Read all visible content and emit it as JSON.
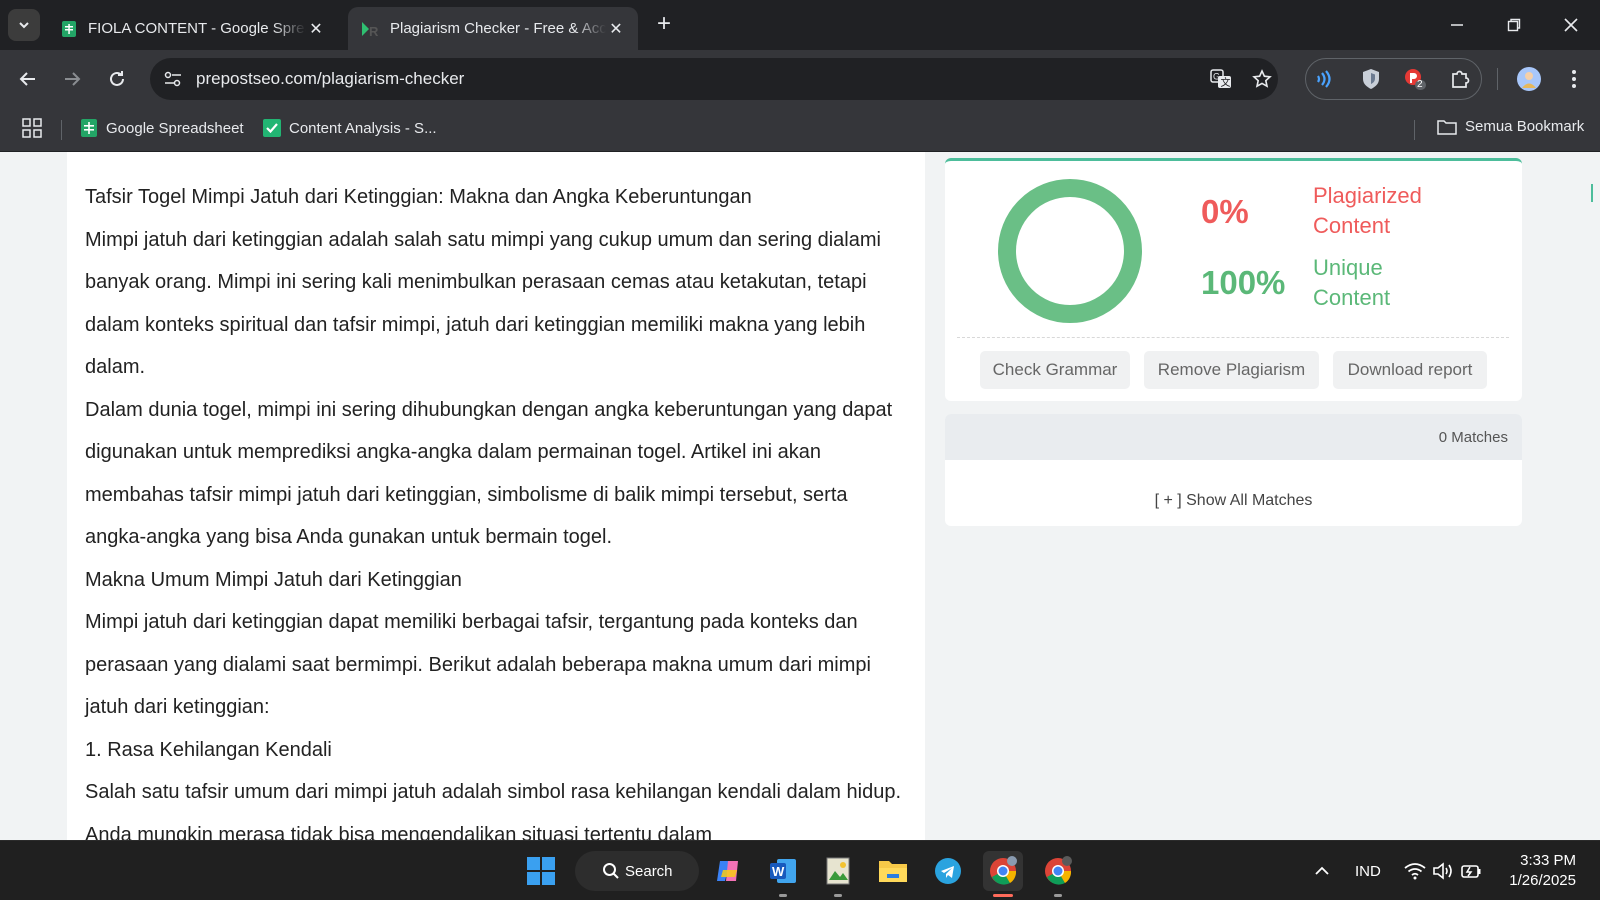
{
  "browser": {
    "tabs": [
      {
        "title": "FIOLA CONTENT - Google Spreadsheet",
        "active": false
      },
      {
        "title": "Plagiarism Checker - Free & Accurate",
        "active": true
      }
    ],
    "url": "prepostseo.com/plagiarism-checker",
    "bookmarks": [
      "Google Spreadsheet",
      "Content Analysis - S..."
    ],
    "all_bookmarks_label": "Semua Bookmark",
    "extension_badge": "2"
  },
  "article": {
    "paragraphs": [
      "Tafsir Togel Mimpi Jatuh dari Ketinggian: Makna dan Angka Keberuntungan",
      " Mimpi jatuh dari ketinggian adalah salah satu mimpi yang cukup umum dan sering dialami banyak orang. Mimpi ini sering kali menimbulkan perasaan cemas atau ketakutan, tetapi dalam konteks spiritual dan tafsir mimpi, jatuh dari ketinggian memiliki makna yang lebih dalam.",
      " Dalam dunia togel, mimpi ini sering dihubungkan dengan angka keberuntungan yang dapat digunakan untuk memprediksi angka-angka dalam permainan togel. Artikel ini akan membahas tafsir mimpi jatuh dari ketinggian, simbolisme di balik mimpi tersebut, serta angka-angka yang bisa Anda gunakan untuk bermain togel.",
      " Makna Umum Mimpi Jatuh dari Ketinggian",
      " Mimpi jatuh dari ketinggian dapat memiliki berbagai tafsir, tergantung pada konteks dan perasaan yang dialami saat bermimpi. Berikut adalah beberapa makna umum dari mimpi jatuh dari ketinggian:",
      " 1. Rasa Kehilangan Kendali",
      " Salah satu tafsir umum dari mimpi jatuh adalah simbol rasa kehilangan kendali dalam hidup. Anda mungkin merasa tidak bisa mengendalikan situasi tertentu dalam"
    ]
  },
  "result": {
    "plagiarized_pct": "0%",
    "plagiarized_label_1": "Plagiarized",
    "plagiarized_label_2": "Content",
    "unique_pct": "100%",
    "unique_label_1": "Unique",
    "unique_label_2": "Content",
    "unique_fraction": 1.0,
    "buttons": {
      "check_grammar": "Check Grammar",
      "remove_plagiarism": "Remove Plagiarism",
      "download_report": "Download report"
    }
  },
  "matches": {
    "count_label": "0 Matches",
    "show_all": "[ + ] Show All Matches"
  },
  "taskbar": {
    "search_label": "Search",
    "language": "IND",
    "time": "3:33 PM",
    "date": "1/26/2025"
  },
  "colors": {
    "accent_green": "#6abf86",
    "plagiarized_red": "#ef5b5b",
    "unique_green": "#5bb878",
    "chrome_dark": "#202124",
    "chrome_toolbar": "#35363a"
  }
}
